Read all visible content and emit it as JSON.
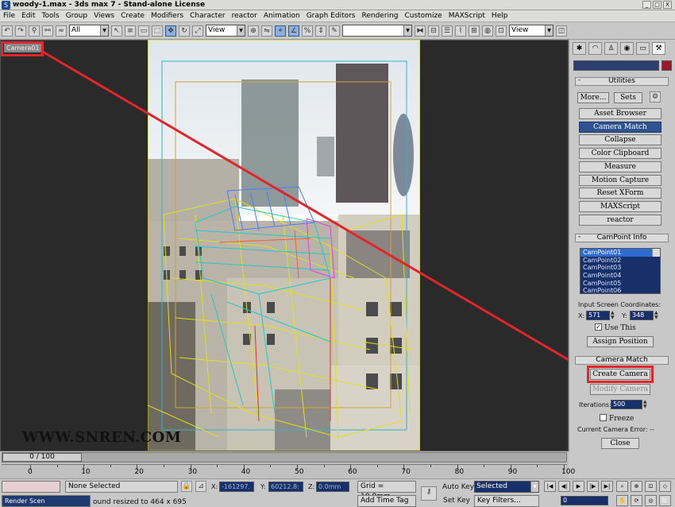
{
  "app": {
    "title": "woody-1.max - 3ds max 7 - Stand-alone License",
    "icon_name": "3dsmax-app-icon"
  },
  "window_controls": [
    "_",
    "□",
    "X"
  ],
  "menu": [
    "File",
    "Edit",
    "Tools",
    "Group",
    "Views",
    "Create",
    "Modifiers",
    "Character",
    "reactor",
    "Animation",
    "Graph Editors",
    "Rendering",
    "Customize",
    "MAXScript",
    "Help"
  ],
  "toolbar": {
    "selection_filter": "All",
    "ref_coord": "View",
    "view_dropdown": "View",
    "named_sets": ""
  },
  "viewport": {
    "label": "Camera01",
    "border_color": "#e0262b"
  },
  "watermark": "WWW.SNREN.COM",
  "command_panel": {
    "rollout_utilities": "Utilities",
    "more_button": "More...",
    "sets_button": "Sets",
    "utilities": [
      "Asset Browser",
      "Camera Match",
      "Collapse",
      "Color Clipboard",
      "Measure",
      "Motion Capture",
      "Reset XForm",
      "MAXScript",
      "reactor"
    ],
    "selected_utility": "Camera Match",
    "rollout_campoint": "CamPoint Info",
    "campoints": [
      "CamPoint01",
      "CamPoint02",
      "CamPoint03",
      "CamPoint04",
      "CamPoint05",
      "CamPoint06"
    ],
    "selected_campoint": "CamPoint01",
    "input_coords_label": "Input Screen Coordinates:",
    "x_label": "X:",
    "x_value": "571",
    "y_label": "Y:",
    "y_value": "348",
    "use_this_label": "Use This",
    "use_this_checked": true,
    "assign_position": "Assign Position",
    "rollout_camera_match": "Camera Match",
    "create_camera": "Create Camera",
    "modify_camera": "Modify Camera",
    "iterations_label": "Iterations:",
    "iterations_value": "500",
    "freeze_label": "Freeze",
    "camera_error_label": "Current Camera Error: --",
    "close_button": "Close"
  },
  "timeline": {
    "slider_label": "0 / 100",
    "ticks": [
      "0",
      "10",
      "20",
      "30",
      "40",
      "50",
      "60",
      "70",
      "80",
      "90",
      "100"
    ]
  },
  "status": {
    "selection": "None Selected",
    "x_label": "X:",
    "x_value": "-161297.",
    "y_label": "Y:",
    "y_value": "60212.8:",
    "z_label": "Z:",
    "z_value": "0.0mm",
    "grid": "Grid = 10.0mm",
    "auto_key": "Auto Key",
    "auto_key_value": "Selected",
    "set_key": "Set Key",
    "key_filters": "Key Filters...",
    "frame_value": "0",
    "prompt": "ound resized to 464 x 695",
    "add_time_tag": "Add Time Tag",
    "render_scene": "Render Scen"
  }
}
